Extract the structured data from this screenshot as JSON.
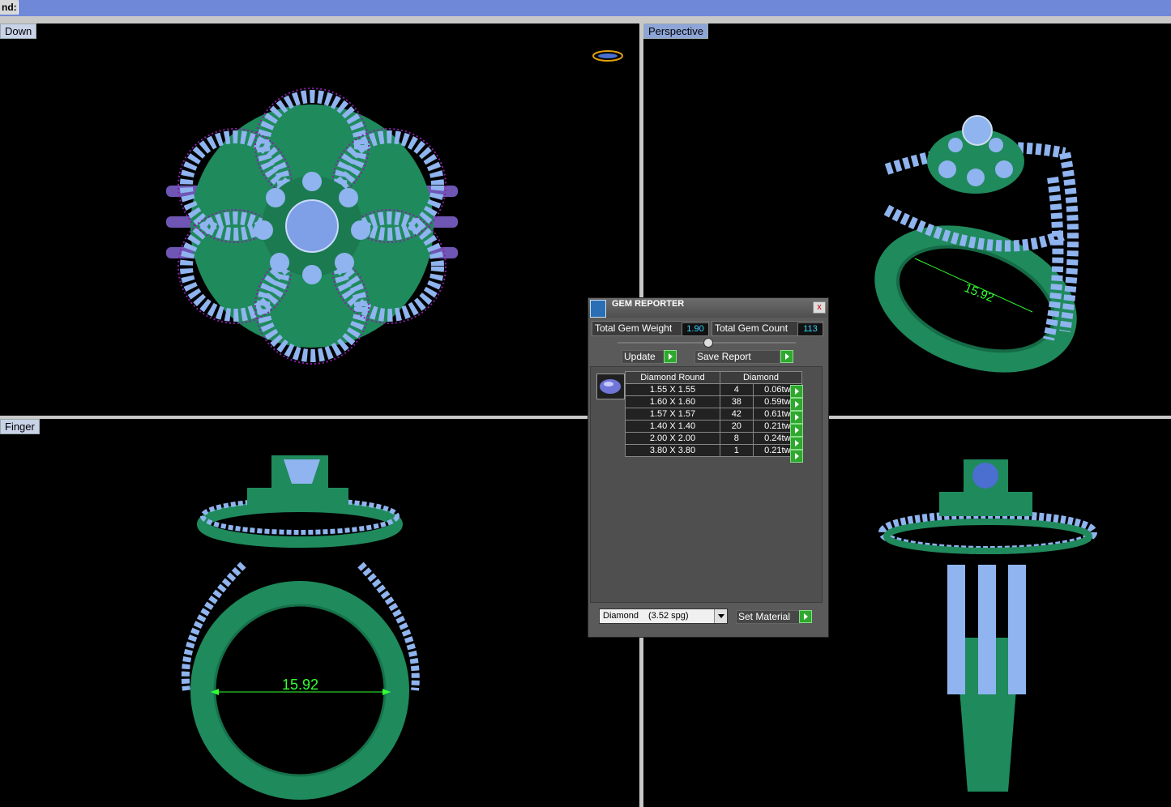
{
  "command_bar": {
    "label": "nd:"
  },
  "viewports": {
    "down": {
      "title": "Down"
    },
    "perspective": {
      "title": "Perspective"
    },
    "finger": {
      "title": "Finger",
      "dimension": "15.92"
    },
    "perspective_dimension": "15.92"
  },
  "gem_reporter": {
    "title": "GEM REPORTER",
    "close_glyph": "x",
    "total_gem_weight_label": "Total Gem Weight",
    "total_gem_weight": "1.90",
    "total_gem_count_label": "Total Gem Count",
    "total_gem_count": "113",
    "update_label": "Update",
    "save_report_label": "Save Report",
    "table": {
      "headers": [
        "Diamond Round",
        "Diamond"
      ],
      "rows": [
        {
          "size": "1.55 X 1.55",
          "count": "4",
          "weight": "0.06tw"
        },
        {
          "size": "1.60 X 1.60",
          "count": "38",
          "weight": "0.59tw"
        },
        {
          "size": "1.57 X 1.57",
          "count": "42",
          "weight": "0.61tw"
        },
        {
          "size": "1.40 X 1.40",
          "count": "20",
          "weight": "0.21tw"
        },
        {
          "size": "2.00 X 2.00",
          "count": "8",
          "weight": "0.24tw"
        },
        {
          "size": "3.80 X 3.80",
          "count": "1",
          "weight": "0.21tw"
        }
      ]
    },
    "material_name": "Diamond",
    "material_density": "(3.52 spg)",
    "set_material_label": "Set Material"
  },
  "colors": {
    "metal": "#1f8a5c",
    "gem": "#8fb4ef",
    "prong": "#8a1fa8",
    "dimension": "#33ff33"
  }
}
